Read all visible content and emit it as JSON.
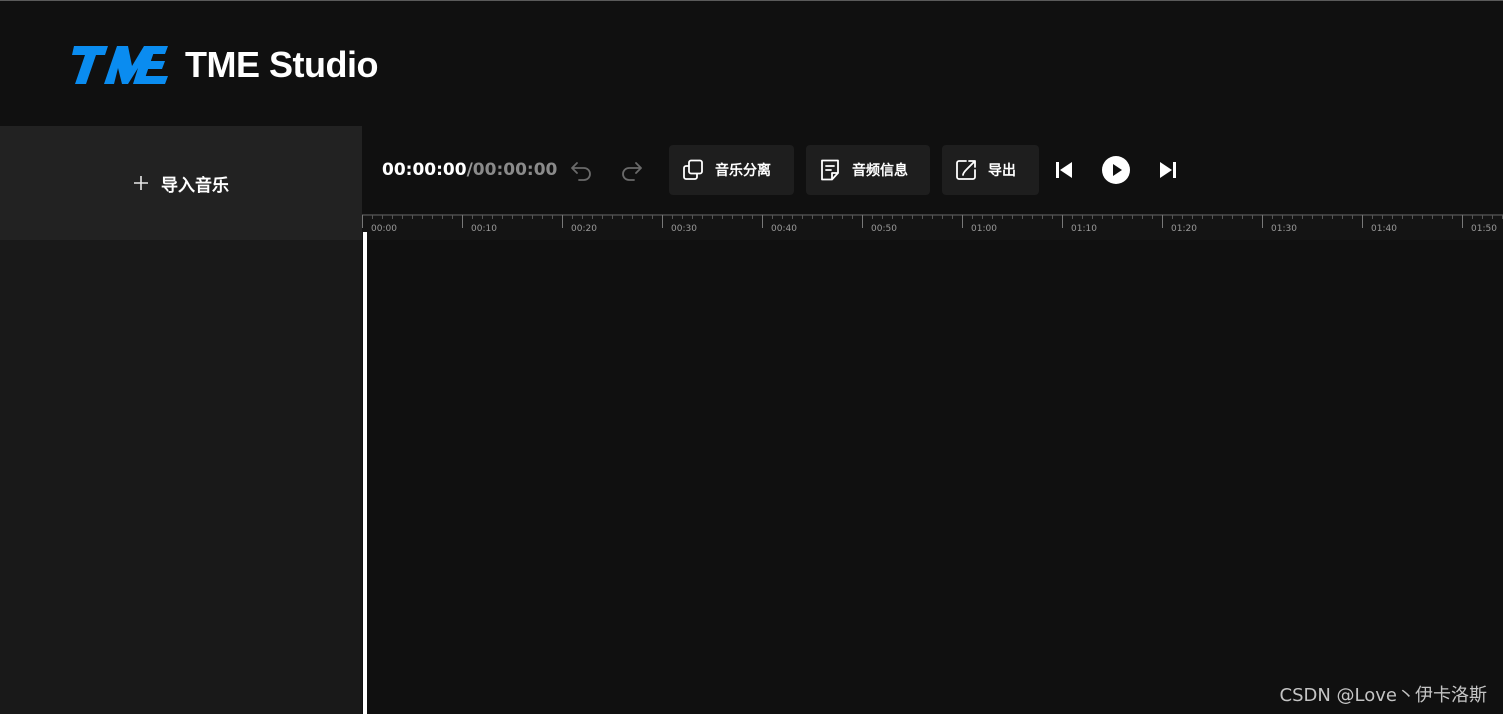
{
  "app": {
    "title": "TME Studio",
    "logo_icon": "tme-logo-icon",
    "brand_color": "#0a8cf0"
  },
  "sidebar": {
    "import_label": "导入音乐",
    "import_icon": "plus-icon"
  },
  "toolbar": {
    "current_time": "00:00:00",
    "separator": "/",
    "total_time": "00:00:00",
    "undo_icon": "undo-icon",
    "redo_icon": "redo-icon",
    "buttons": [
      {
        "label": "音乐分离",
        "icon": "copy-icon"
      },
      {
        "label": "音频信息",
        "icon": "document-icon"
      },
      {
        "label": "导出",
        "icon": "export-icon"
      }
    ],
    "playback": {
      "prev_icon": "skip-back-icon",
      "play_icon": "play-icon",
      "next_icon": "skip-forward-icon"
    }
  },
  "timeline": {
    "ticks": [
      "00:00",
      "00:10",
      "00:20",
      "00:30",
      "00:40",
      "00:50",
      "01:00",
      "01:10",
      "01:20",
      "01:30",
      "01:40",
      "01:50"
    ]
  },
  "watermark": "CSDN @Love丶伊卡洛斯"
}
